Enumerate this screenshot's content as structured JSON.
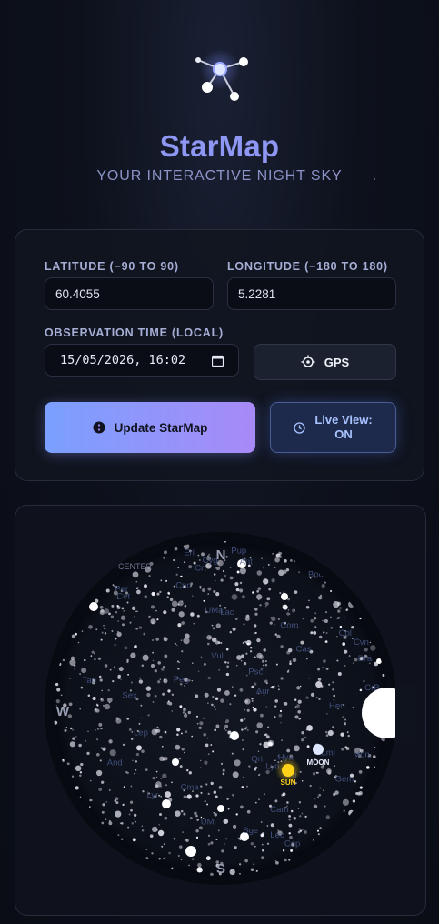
{
  "header": {
    "logo_icon": "constellation-icon",
    "title": "StarMap",
    "subtitle": "YOUR INTERACTIVE NIGHT SKY"
  },
  "form": {
    "latitude": {
      "label": "LATITUDE (−90 TO 90)",
      "value": "60.4055"
    },
    "longitude": {
      "label": "LONGITUDE (−180 TO 180)",
      "value": "5.2281"
    },
    "time": {
      "label": "OBSERVATION TIME (LOCAL)",
      "value": "15/05/2026, 16:02"
    },
    "gps_label": "GPS",
    "update_label": "Update StarMap",
    "live_label_1": "Live View:",
    "live_label_2": "ON"
  },
  "skymap": {
    "directions": {
      "north": "N",
      "south": "S",
      "west": "W"
    },
    "constellations": [
      "Her",
      "CrB",
      "Boo",
      "Cvn",
      "Com",
      "UMa",
      "Lmi",
      "Leo",
      "Sex",
      "Crt",
      "Hya",
      "Lyn",
      "Cnc",
      "Ant",
      "Mon",
      "Cma",
      "Pup",
      "Cam",
      "Aur",
      "Per",
      "Tri",
      "Cet",
      "Eri",
      "Cas",
      "Cep",
      "And",
      "Lac",
      "Cyg",
      "Dra",
      "UMi",
      "Gem",
      "Ori",
      "Lep",
      "Col",
      "Psc",
      "Tau",
      "Lyr",
      "Vul",
      "Peg",
      "Sge"
    ],
    "fragment_label": "CENTER",
    "bodies": [
      {
        "name": "MOON",
        "color": "#e6ecff"
      },
      {
        "name": "SUN",
        "color": "#ffd21a"
      }
    ],
    "moon_disc_icon": "moon-phase-icon"
  },
  "colors": {
    "accent": "#8f97f4",
    "gradient_start": "#7aa0ff",
    "gradient_end": "#a88af7",
    "live": "#a8c2ff"
  }
}
